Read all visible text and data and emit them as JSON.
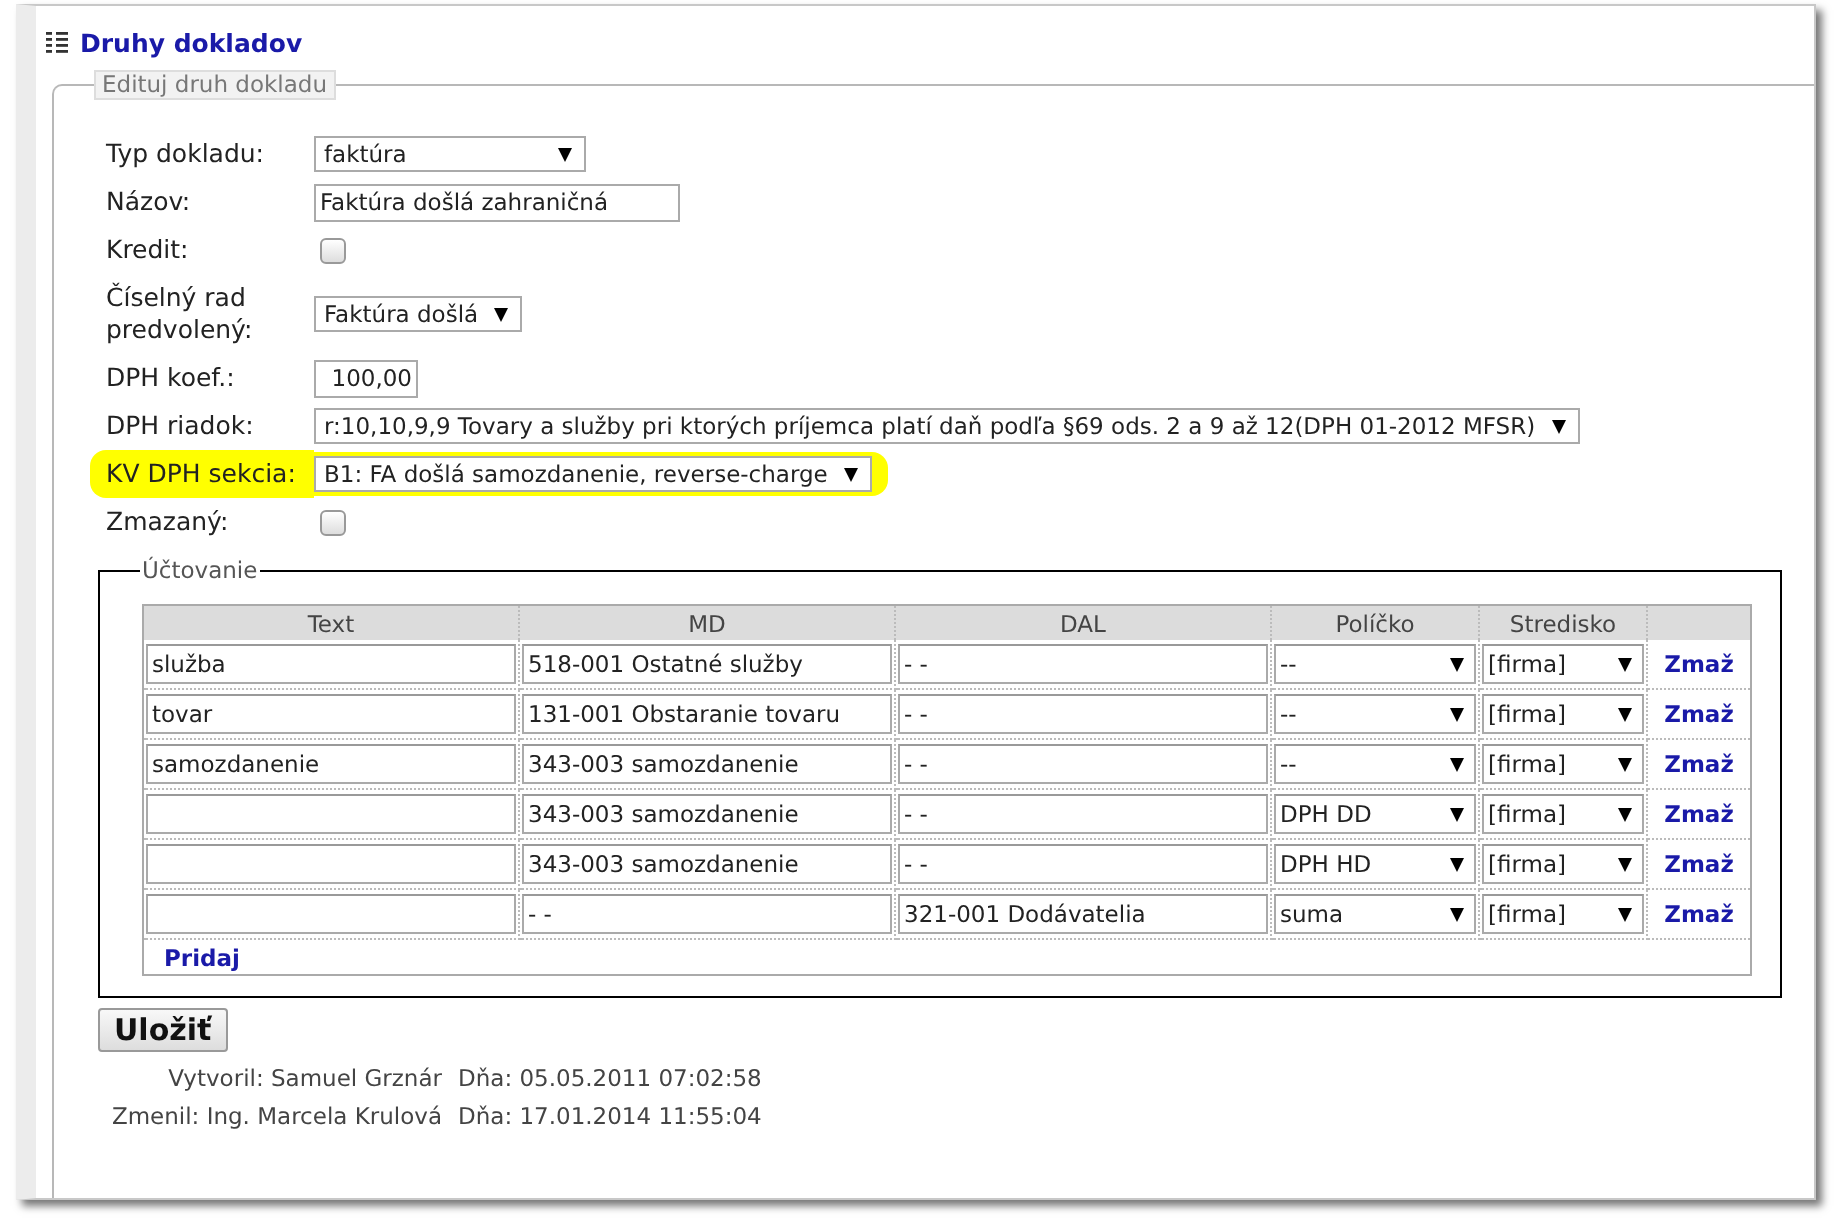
{
  "title": "Druhy dokladov",
  "form": {
    "legend": "Edituj druh dokladu",
    "fields": [
      {
        "kind": "select",
        "label": "Typ dokladu:",
        "value": "faktúra",
        "highlighted": false
      },
      {
        "kind": "text",
        "label": "Názov:",
        "value": "Faktúra došlá zahraničná",
        "highlighted": false
      },
      {
        "kind": "checkbox",
        "label": "Kredit:",
        "checked": false,
        "highlighted": false
      },
      {
        "kind": "select",
        "label": "Číselný rad predvolený:",
        "value": "Faktúra došlá",
        "highlighted": false
      },
      {
        "kind": "number",
        "label": "DPH koef.:",
        "value": "100,00",
        "highlighted": false
      },
      {
        "kind": "select",
        "label": "DPH riadok:",
        "value": "r:10,10,9,9 Tovary a služby pri ktorých príjemca platí daň podľa §69 ods. 2 a 9 až 12(DPH 01-2012 MFSR)",
        "highlighted": false
      },
      {
        "kind": "select",
        "label": "KV DPH sekcia:",
        "value": "B1: FA došlá samozdanenie, reverse-charge",
        "highlighted": true
      },
      {
        "kind": "checkbox",
        "label": "Zmazaný:",
        "checked": false,
        "highlighted": false
      }
    ]
  },
  "accounting": {
    "legend": "Účtovanie",
    "columns": [
      "Text",
      "MD",
      "DAL",
      "Políčko",
      "Stredisko"
    ],
    "rows": [
      {
        "text": "služba",
        "md": "518-001 Ostatné služby",
        "dal": "- -",
        "policko": "--",
        "stredisko": "[firma]",
        "action": "Zmaž"
      },
      {
        "text": "tovar",
        "md": "131-001 Obstaranie tovaru",
        "dal": "- -",
        "policko": "--",
        "stredisko": "[firma]",
        "action": "Zmaž"
      },
      {
        "text": "samozdanenie",
        "md": "343-003 samozdanenie",
        "dal": "- -",
        "policko": "--",
        "stredisko": "[firma]",
        "action": "Zmaž"
      },
      {
        "md": "343-003 samozdanenie",
        "dal": "- -",
        "policko": "DPH DD",
        "stredisko": "[firma]",
        "action": "Zmaž"
      },
      {
        "md": "343-003 samozdanenie",
        "dal": "- -",
        "policko": "DPH HD",
        "stredisko": "[firma]",
        "action": "Zmaž"
      },
      {
        "md": "- -",
        "dal": "321-001 Dodávatelia",
        "policko": "suma",
        "stredisko": "[firma]",
        "action": "Zmaž"
      }
    ],
    "add_link": "Pridaj"
  },
  "save_button": "Uložiť",
  "meta": [
    {
      "author": "Vytvoril: Samuel Grznár",
      "date": "Dňa: 05.05.2011 07:02:58"
    },
    {
      "author": "Zmenil: Ing. Marcela Krulová",
      "date": "Dňa: 17.01.2014 11:55:04"
    }
  ]
}
